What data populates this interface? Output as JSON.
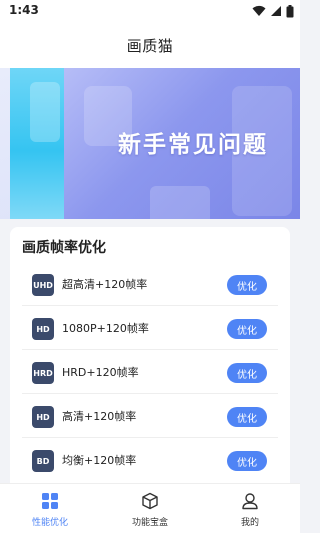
{
  "status_bar": {
    "time": "1:43",
    "icons": [
      "wifi-icon",
      "signal-icon",
      "battery-icon"
    ]
  },
  "header": {
    "title": "画质猫"
  },
  "banner": {
    "text": "新手常见问题"
  },
  "card": {
    "title": "画质帧率优化",
    "options": [
      {
        "badge": "UHD",
        "label": "超高清+120帧率",
        "button": "优化"
      },
      {
        "badge": "HD",
        "label": "1080P+120帧率",
        "button": "优化"
      },
      {
        "badge": "HRD",
        "label": "HRD+120帧率",
        "button": "优化"
      },
      {
        "badge": "HD",
        "label": "高清+120帧率",
        "button": "优化"
      },
      {
        "badge": "BD",
        "label": "均衡+120帧率",
        "button": "优化"
      }
    ]
  },
  "tabs": [
    {
      "label": "性能优化",
      "icon": "grid-icon",
      "active": true
    },
    {
      "label": "功能宝盒",
      "icon": "box-icon",
      "active": false
    },
    {
      "label": "我的",
      "icon": "user-icon",
      "active": false
    }
  ],
  "colors": {
    "accent": "#4f84f5",
    "badge": "#3b4a6b",
    "background": "#f2f3f7"
  }
}
